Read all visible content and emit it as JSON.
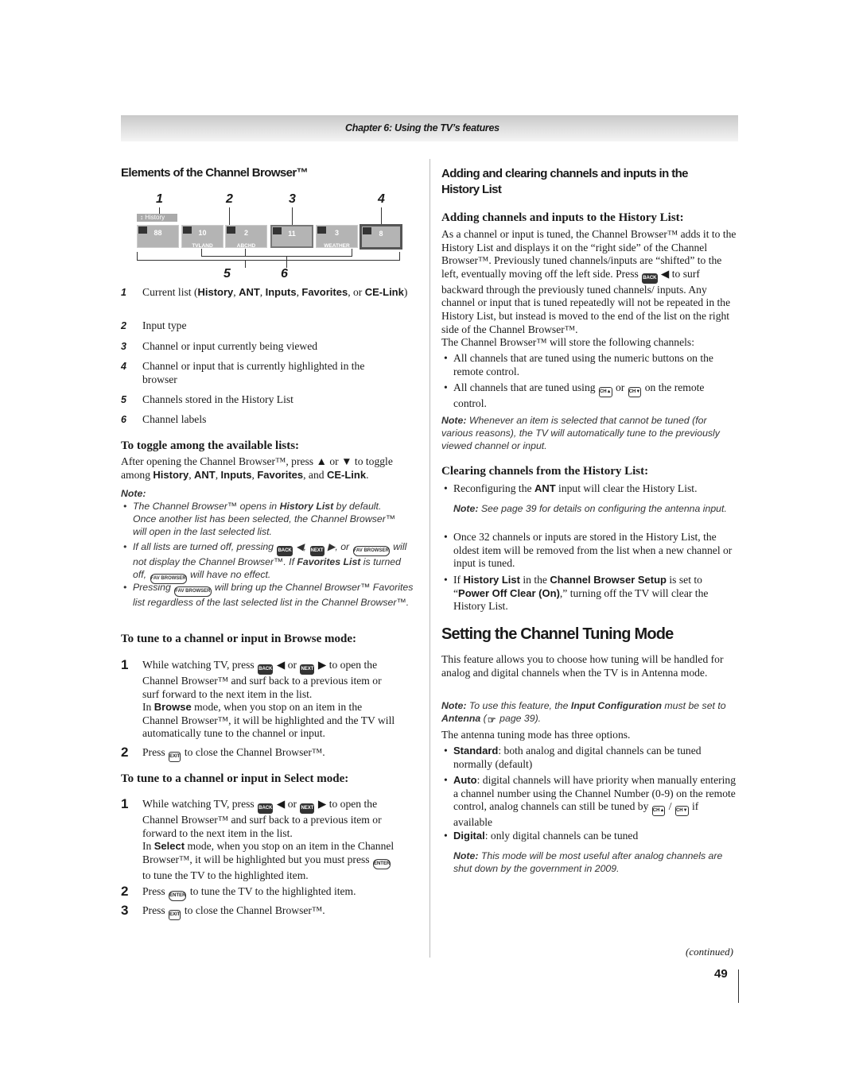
{
  "header": {
    "chapter": "Chapter 6: Using the TV’s features"
  },
  "left": {
    "elements_heading": "Elements of the Channel Browser™",
    "diagram": {
      "callouts": [
        "1",
        "2",
        "3",
        "4",
        "5",
        "6"
      ],
      "list_label": "History",
      "tiles": [
        {
          "channel": "88",
          "label": ""
        },
        {
          "channel": "10",
          "label": "TVLAND"
        },
        {
          "channel": "2",
          "label": "ABCHD"
        },
        {
          "channel": "11",
          "label": "",
          "state": "current"
        },
        {
          "channel": "3",
          "label": "WEATHER"
        },
        {
          "channel": "8",
          "label": "",
          "state": "highlighted"
        }
      ]
    },
    "elements": [
      {
        "n": "1",
        "text": [
          "Current list (",
          {
            "b": "History"
          },
          ", ",
          {
            "b": "ANT"
          },
          ", ",
          {
            "b": "Inputs"
          },
          ", ",
          {
            "b": "Favorites"
          },
          ", or ",
          {
            "b": "CE-Link"
          },
          ")"
        ]
      },
      {
        "n": "2",
        "text": [
          "Input type"
        ]
      },
      {
        "n": "3",
        "text": [
          "Channel or input currently being viewed"
        ]
      },
      {
        "n": "4",
        "text": [
          "Channel or input that is currently highlighted in the browser"
        ]
      },
      {
        "n": "5",
        "text": [
          "Channels stored in the History List"
        ]
      },
      {
        "n": "6",
        "text": [
          "Channel labels"
        ]
      }
    ],
    "toggle_heading": "To toggle among the available lists:",
    "toggle_text": [
      "After opening the Channel Browser™, press ▲ or ▼ to toggle among ",
      {
        "b": "History"
      },
      ", ",
      {
        "b": "ANT"
      },
      ", ",
      {
        "b": "Inputs"
      },
      ", ",
      {
        "b": "Favorites"
      },
      ", and ",
      {
        "b": "CE-Link"
      },
      "."
    ],
    "note_label": "Note:",
    "notes": [
      [
        "The Channel Browser™ opens in ",
        {
          "b": "History List"
        },
        " by default. Once another list has been selected, the Channel Browser™ will open in the last selected list."
      ],
      [
        "If all lists are turned off, pressing ",
        {
          "i": "back"
        },
        " ◀, ",
        {
          "i": "next"
        },
        " ▶, or ",
        {
          "i": "fav"
        },
        " will not display the Channel Browser™. If ",
        {
          "b": "Favorites List"
        },
        " is turned off, ",
        {
          "i": "fav"
        },
        " will have no effect."
      ],
      [
        "Pressing ",
        {
          "i": "fav"
        },
        " will bring up the Channel Browser™ Favorites list regardless of the last selected list in the Channel Browser™."
      ]
    ],
    "browse_heading": "To tune to a channel or input in Browse mode:",
    "browse_steps": [
      {
        "n": "1",
        "text": [
          "While watching TV, press ",
          {
            "i": "back"
          },
          " ◀ or ",
          {
            "i": "next"
          },
          " ▶ to open the Channel Browser™ and surf back to a previous item or surf forward to the next item in the list."
        ],
        "sub": [
          "In ",
          {
            "b": "Browse"
          },
          " mode, when you stop on an item in the Channel Browser™, it will be highlighted and the TV will automatically tune to the channel or input."
        ]
      },
      {
        "n": "2",
        "text": [
          "Press ",
          {
            "i": "exit"
          },
          " to close the Channel Browser™."
        ]
      }
    ],
    "select_heading": "To tune to a channel or input in Select mode:",
    "select_steps": [
      {
        "n": "1",
        "text": [
          "While watching TV, press ",
          {
            "i": "back"
          },
          " ◀ or ",
          {
            "i": "next"
          },
          " ▶ to open the Channel Browser™ and surf back to a previous item or forward to the next item in the list."
        ],
        "sub": [
          "In ",
          {
            "b": "Select"
          },
          " mode, when you stop on an item in the Channel Browser™, it will be highlighted but you must press ",
          {
            "i": "enter"
          },
          " to tune the TV to the highlighted item."
        ]
      },
      {
        "n": "2",
        "text": [
          "Press ",
          {
            "i": "enter"
          },
          " to tune the TV to the highlighted item."
        ]
      },
      {
        "n": "3",
        "text": [
          "Press ",
          {
            "i": "exit"
          },
          " to close the Channel Browser™."
        ]
      }
    ]
  },
  "right": {
    "adding_heading": "Adding and clearing channels and inputs in the History List",
    "adding_sub": "Adding channels and inputs to the History List:",
    "adding_p1": [
      "As a channel or input is tuned, the Channel Browser™ adds it to the History List and displays it on the “right side” of the Channel Browser™. Previously tuned channels/inputs are “shifted” to the left, eventually moving off the left side. Press ",
      {
        "i": "back"
      },
      " ◀ to surf backward through the previously tuned channels/ inputs. Any channel or input that is tuned repeatedly will not be repeated in the History List, but instead is moved to the end of the list on the right side of the Channel Browser™."
    ],
    "adding_p2": [
      "The Channel Browser™ will store the following channels:"
    ],
    "adding_bullets": [
      [
        "All channels that are tuned using the numeric buttons on the remote control."
      ],
      [
        "All channels that are tuned using ",
        {
          "i": "chup"
        },
        " or ",
        {
          "i": "chdn"
        },
        " on the remote control."
      ]
    ],
    "note1": [
      {
        "nl": "Note:"
      },
      " Whenever an item is selected that cannot be tuned (for various reasons), the TV will automatically tune to the previously viewed channel or input."
    ],
    "clearing_sub": "Clearing channels from the History List:",
    "clear_bullet1": [
      "Reconfiguring the ",
      {
        "b": "ANT"
      },
      " input will clear the History List."
    ],
    "note2": [
      {
        "nl": "Note:"
      },
      " See page 39 for details on configuring the antenna input."
    ],
    "clear_bullets": [
      [
        "Once 32 channels or inputs are stored in the History List, the oldest item will be removed from the list when a new channel or input is tuned."
      ],
      [
        "If ",
        {
          "b": "History List"
        },
        " in the ",
        {
          "b": "Channel Browser Setup"
        },
        " is set to “",
        {
          "b": "Power Off Clear (On)"
        },
        ",” turning off the TV will clear the History List."
      ]
    ],
    "tuning_heading": "Setting the Channel Tuning Mode",
    "tuning_p1": [
      "This feature allows you to choose how tuning will be handled for analog and digital channels when the TV is in Antenna mode."
    ],
    "note3": [
      {
        "nl": "Note:"
      },
      " To use this feature, the ",
      {
        "b": "Input Configuration"
      },
      " must be set to ",
      {
        "b": "Antenna"
      },
      " (",
      {
        "i": "ref"
      },
      " page 39)."
    ],
    "tuning_p2": [
      "The antenna tuning mode has three options."
    ],
    "tuning_bullets": [
      [
        {
          "b": "Standard"
        },
        ": both analog and digital channels can be tuned normally (default)"
      ],
      [
        {
          "b": "Auto"
        },
        ": digital channels will have priority when manually entering a channel number using the Channel Number (0-9) on the remote control, analog channels can still be tuned by ",
        {
          "i": "chup"
        },
        " / ",
        {
          "i": "chdn"
        },
        " if available"
      ],
      [
        {
          "b": "Digital"
        },
        ": only digital channels can be tuned"
      ]
    ],
    "note4": [
      {
        "nl": "Note:"
      },
      " This mode will be most useful after analog channels are shut down by the government in 2009."
    ],
    "continued": "(continued)"
  },
  "page_number": "49",
  "icons": {
    "back": {
      "name": "back-button-icon",
      "text": "BACK"
    },
    "next": {
      "name": "next-button-icon",
      "text": "NEXT"
    },
    "fav": {
      "name": "fav-browser-button-icon",
      "text": "FAV BROWSER"
    },
    "exit": {
      "name": "exit-button-icon",
      "text": "EXIT"
    },
    "enter": {
      "name": "enter-button-icon",
      "text": "ENTER"
    },
    "chup": {
      "name": "channel-up-button-icon",
      "text": "CH▲"
    },
    "chdn": {
      "name": "channel-down-button-icon",
      "text": "CH▼"
    },
    "ref": {
      "name": "page-reference-icon",
      "text": "☞"
    }
  }
}
